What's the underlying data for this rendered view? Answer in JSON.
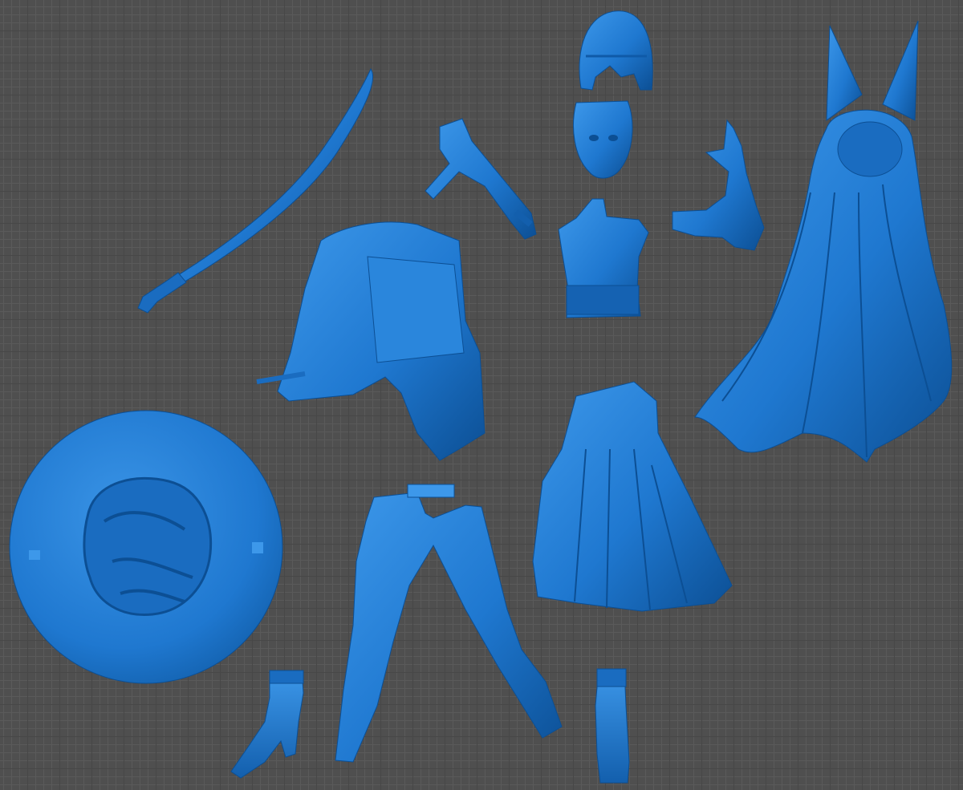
{
  "viewport": {
    "background": "#4f4f4f",
    "grid_minor": "#5a5a5a",
    "grid_major": "#474747"
  },
  "model": {
    "color_base": "#1f78d0",
    "color_light": "#3d98ea",
    "color_dark": "#0c4f94",
    "color_shadow": "#083a70",
    "parts": [
      {
        "id": "katana",
        "icon": "katana-blade"
      },
      {
        "id": "hair-bangs",
        "icon": "hair-piece"
      },
      {
        "id": "head",
        "icon": "head-face"
      },
      {
        "id": "pipe-weapon",
        "icon": "club-weapon"
      },
      {
        "id": "raised-arm",
        "icon": "arm-hand"
      },
      {
        "id": "torso",
        "icon": "torso-bust"
      },
      {
        "id": "long-hair-ears",
        "icon": "hair-with-ears"
      },
      {
        "id": "jacket",
        "icon": "jacket"
      },
      {
        "id": "skirt",
        "icon": "pleated-skirt"
      },
      {
        "id": "display-base",
        "icon": "round-base"
      },
      {
        "id": "legs",
        "icon": "leg-pair"
      },
      {
        "id": "boot-left",
        "icon": "heeled-boot"
      },
      {
        "id": "boot-right",
        "icon": "short-boot"
      }
    ]
  }
}
